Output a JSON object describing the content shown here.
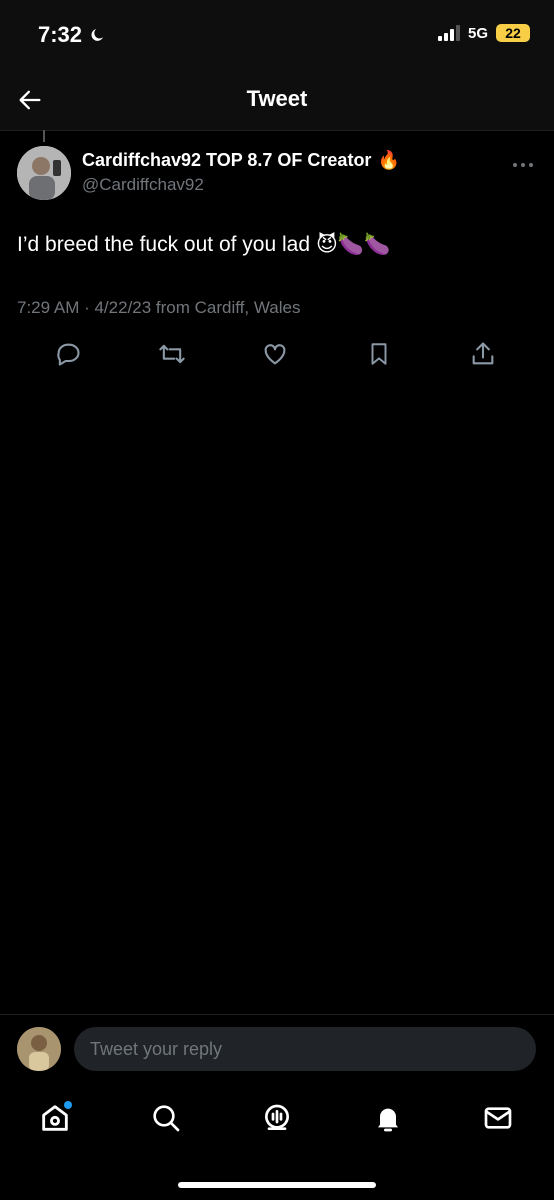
{
  "status_bar": {
    "time": "7:32",
    "network": "5G",
    "battery": "22"
  },
  "header": {
    "title": "Tweet"
  },
  "tweet": {
    "display_name": "Cardiffchav92 TOP 8.7 OF Creator",
    "name_emoji": "🔥",
    "handle": "@Cardiffchav92",
    "text": "I’d breed the fuck out of you lad",
    "text_emojis": "😈🍆🍆",
    "meta": "7:29 AM · 4/22/23 from Cardiff, Wales"
  },
  "reply": {
    "placeholder": "Tweet your reply"
  },
  "icons": {
    "back": "arrow-left-icon",
    "more": "more-dots-icon",
    "actions": [
      "reply-icon",
      "retweet-icon",
      "like-icon",
      "bookmark-icon",
      "share-icon"
    ],
    "tabs": [
      "home-icon",
      "search-icon",
      "spaces-icon",
      "notifications-icon",
      "messages-icon"
    ]
  },
  "colors": {
    "background": "#000000",
    "accent": "#1d9bf0",
    "secondary_text": "#71767b",
    "battery": "#f7ce46"
  }
}
